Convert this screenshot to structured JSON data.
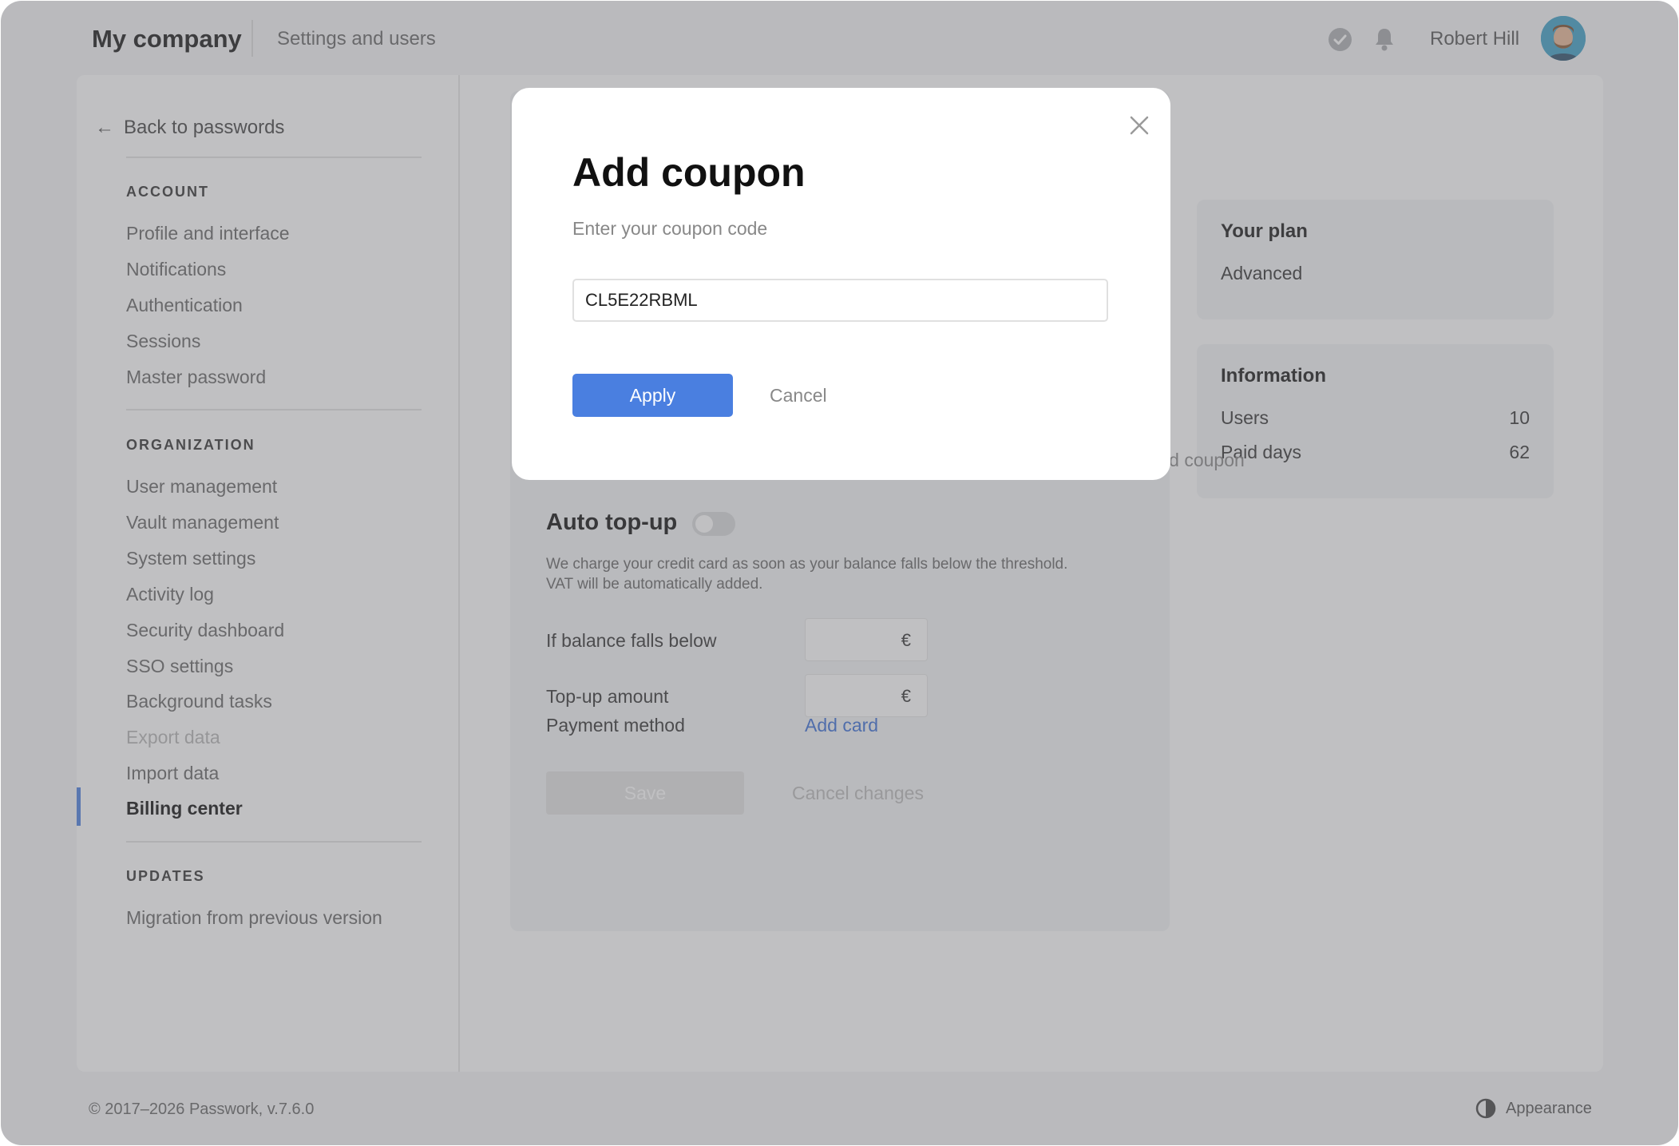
{
  "header": {
    "company": "My company",
    "subtitle": "Settings and users",
    "user_name": "Robert Hill",
    "icons": [
      "check-circle-icon",
      "bell-icon",
      "avatar"
    ]
  },
  "sidebar": {
    "back_label": "Back to passwords",
    "sections": [
      {
        "title": "ACCOUNT",
        "items": [
          "Profile and interface",
          "Notifications",
          "Authentication",
          "Sessions",
          "Master password"
        ]
      },
      {
        "title": "ORGANIZATION",
        "items": [
          "User management",
          "Vault management",
          "System settings",
          "Activity log",
          "Security dashboard",
          "SSO settings",
          "Background tasks",
          "Export data",
          "Import data",
          "Billing center"
        ]
      },
      {
        "title": "UPDATES",
        "items": [
          "Migration from previous version"
        ]
      }
    ],
    "disabled_item": "Export data",
    "active_item": "Billing center"
  },
  "plan": {
    "title": "Your plan",
    "value": "Advanced"
  },
  "information": {
    "title": "Information",
    "rows": [
      {
        "label": "Users",
        "value": "10"
      },
      {
        "label": "Paid days",
        "value": "62"
      }
    ]
  },
  "add_coupon_link": "Add coupon",
  "auto_topup": {
    "title": "Auto top-up",
    "enabled": false,
    "description_line1": "We charge your credit card as soon as your balance falls below the threshold.",
    "description_line2": "VAT will be automatically added.",
    "balance_label": "If balance falls below",
    "amount_label": "Top-up amount",
    "currency": "€",
    "payment_label": "Payment method",
    "add_card": "Add card",
    "save": "Save",
    "cancel_changes": "Cancel changes"
  },
  "modal": {
    "title": "Add coupon",
    "subtitle": "Enter your coupon code",
    "input_value": "CL5E22RBML",
    "apply": "Apply",
    "cancel": "Cancel"
  },
  "footer": {
    "copyright": "© 2017–2026 Passwork, v.7.6.0",
    "appearance": "Appearance"
  },
  "colors": {
    "accent": "#4a7fe0",
    "link": "#3b6fd6",
    "overlay": "rgba(108,110,114,0.43)"
  }
}
